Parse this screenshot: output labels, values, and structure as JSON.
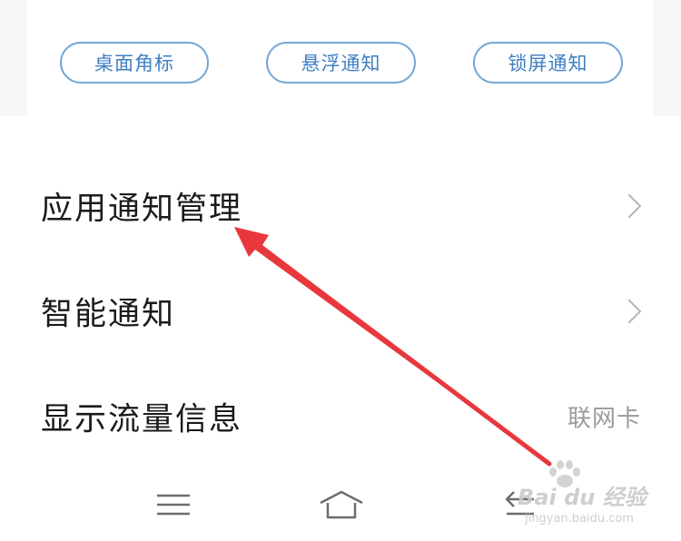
{
  "notification_styles": {
    "buttons": [
      "桌面角标",
      "悬浮通知",
      "锁屏通知"
    ]
  },
  "settings": {
    "items": [
      {
        "label": "应用通知管理",
        "value": "",
        "icon": "chevron-right-icon"
      },
      {
        "label": "智能通知",
        "value": "",
        "icon": "chevron-right-icon"
      },
      {
        "label": "显示流量信息",
        "value": "联网卡"
      }
    ]
  },
  "navbar": {
    "icons": [
      "menu-icon",
      "home-icon",
      "back-icon"
    ]
  },
  "annotation": {
    "arrow_color": "#e8383d"
  },
  "watermark": {
    "main": "Bai du 经验",
    "sub": "jingyan.baidu.com"
  },
  "colors": {
    "button_border": "#74a7d6",
    "button_text": "#3f7fc3",
    "value_text": "#9a9a9a"
  }
}
